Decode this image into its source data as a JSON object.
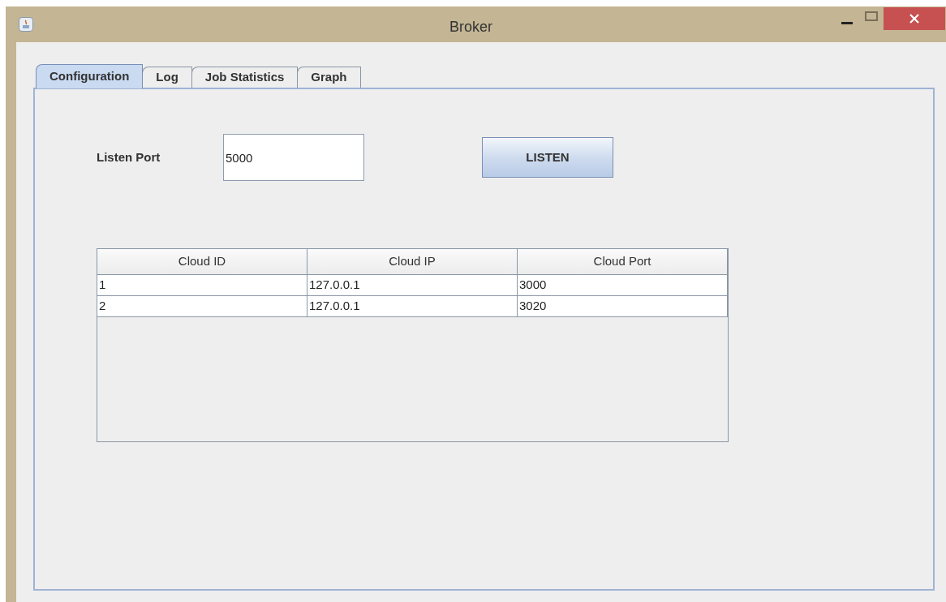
{
  "window": {
    "title": "Broker"
  },
  "tabs": [
    {
      "label": "Configuration",
      "selected": true
    },
    {
      "label": "Log",
      "selected": false
    },
    {
      "label": "Job Statistics",
      "selected": false
    },
    {
      "label": "Graph",
      "selected": false
    }
  ],
  "listen_port": {
    "label": "Listen Port",
    "value": "5000"
  },
  "listen_button": "LISTEN",
  "table": {
    "columns": [
      "Cloud ID",
      "Cloud IP",
      "Cloud Port"
    ],
    "rows": [
      [
        "1",
        "127.0.0.1",
        "3000"
      ],
      [
        "2",
        "127.0.0.1",
        "3020"
      ]
    ]
  }
}
